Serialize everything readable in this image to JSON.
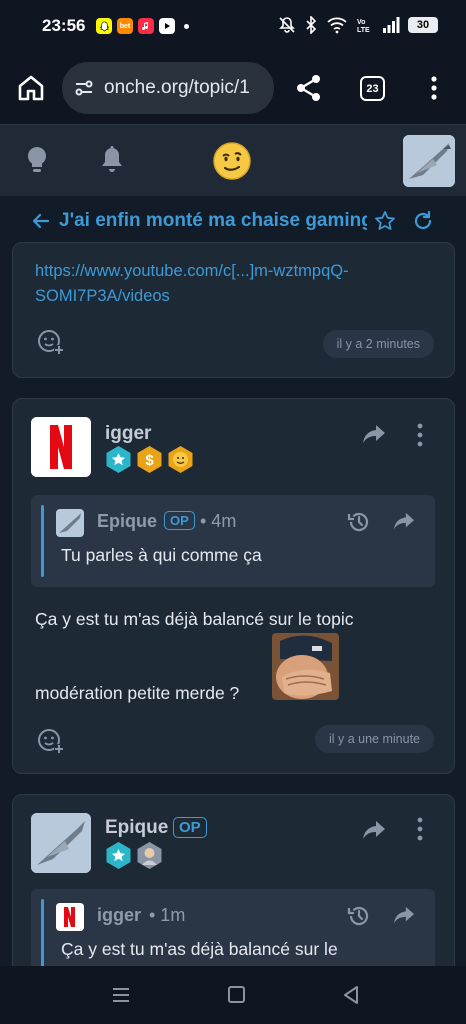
{
  "status_bar": {
    "time": "23:56",
    "battery": "30",
    "apps": [
      "snapchat-icon",
      "bet-icon",
      "music-icon",
      "youtube-icon"
    ],
    "icons": [
      "mute-icon",
      "bluetooth-icon",
      "wifi-icon",
      "volte-icon",
      "signal-icon"
    ]
  },
  "browser": {
    "url": "onche.org/topic/1",
    "tab_count": "23"
  },
  "header": {
    "icons": [
      "lightbulb-icon",
      "bell-icon",
      "smiley-logo",
      "user-avatar"
    ]
  },
  "topic": {
    "title": "J'ai enfin monté ma chaise gaming"
  },
  "posts": [
    {
      "link_line1": "https://www.youtube.com/c[...]m-wztmpqQ-",
      "link_line2": "SOMI7P3A/videos",
      "time": "il y a 2 minutes"
    },
    {
      "username": "igger",
      "quote": {
        "username": "Epique",
        "op_label": "OP",
        "time": "• 4m",
        "text": "Tu parles à qui comme ça"
      },
      "body_line1": "Ça y est tu m'as déjà balancé sur le topic",
      "body_line2": "modération petite merde ?",
      "time": "il y a une minute"
    },
    {
      "username": "Epique",
      "op_label": "OP",
      "quote": {
        "username": "igger",
        "time": "• 1m",
        "text": "Ça y est tu m'as déjà balancé sur le"
      }
    }
  ],
  "colors": {
    "accent": "#3d9ad6",
    "card": "#1e2936",
    "background": "#121c28"
  }
}
